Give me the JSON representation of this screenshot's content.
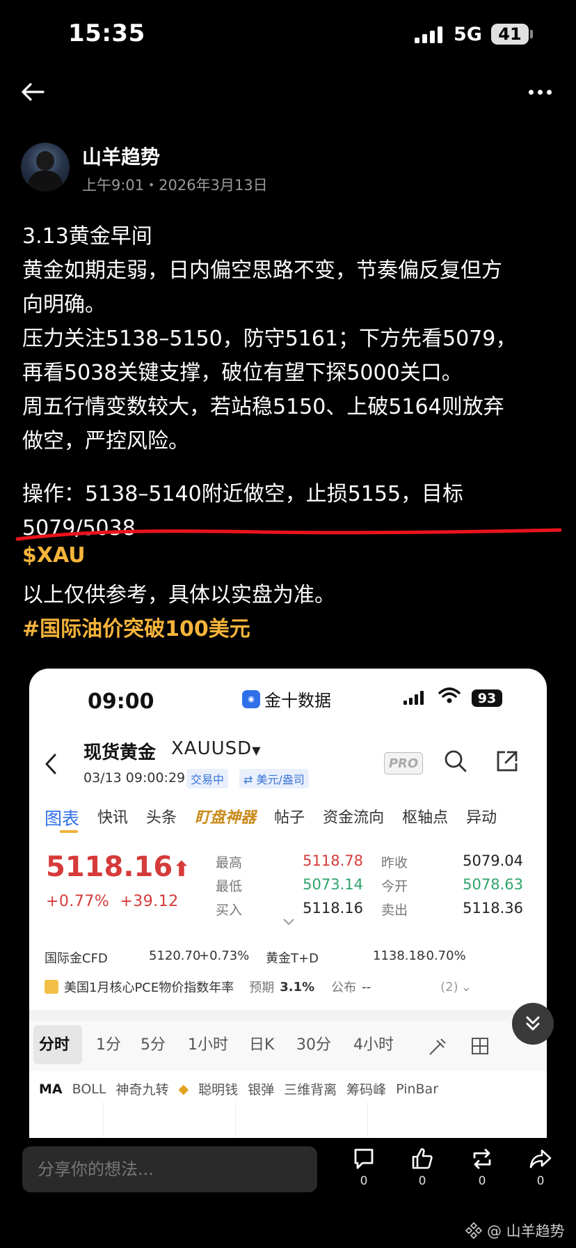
{
  "status_bar": {
    "time": "15:35",
    "network": "5G",
    "battery": "41"
  },
  "post": {
    "author": "山羊趋势",
    "meta": "上午9:01・2026年3月13日",
    "lines": [
      "3.13黄金早间",
      "黄金如期走弱，日内偏空思路不变，节奏偏反复但方",
      "向明确。",
      "压力关注5138–5150，防守5161；下方先看5079，",
      "再看5038关键支撑，破位有望下探5000关口。",
      "周五行情变数较大，若站稳5150、上破5164则放弃",
      "做空，严控风险。"
    ],
    "operation_line1": "操作：5138–5140附近做空，止损5155，目标",
    "operation_line2": "5079/5038",
    "cashtag": "$XAU",
    "disclaimer": "以上仅供参考，具体以实盘为准。",
    "hashtag": "#国际油价突破100美元"
  },
  "screenshot": {
    "status": {
      "time": "09:00",
      "app": "金十数据",
      "battery": "93"
    },
    "title": "现货黄金",
    "symbol": "XAUUSD",
    "datetime": "03/13 09:00:29",
    "badge_trading": "交易中",
    "badge_unit": "⇄ 美元/盎司",
    "pro": "PRO",
    "tabs": [
      "图表",
      "快讯",
      "头条",
      "盯盘神器",
      "帖子",
      "资金流向",
      "枢轴点",
      "异动"
    ],
    "price": "5118.16",
    "change_pct": "+0.77%",
    "change_abs": "+39.12",
    "grid": {
      "high_label": "最高",
      "high": "5118.78",
      "low_label": "最低",
      "low": "5073.14",
      "bid_label": "买入",
      "bid": "5118.16",
      "prev_close_label": "昨收",
      "prev_close": "5079.04",
      "open_label": "今开",
      "open": "5078.63",
      "ask_label": "卖出",
      "ask": "5118.36"
    },
    "cfd": {
      "label": "国际金CFD",
      "value": "5120.70",
      "pct": "+0.73%"
    },
    "td": {
      "label": "黄金T+D",
      "value": "1138.18",
      "pct": "-0.70%"
    },
    "pce": {
      "label": "美国1月核心PCE物价指数年率",
      "expect_label": "预期",
      "expect": "3.1%",
      "publish_label": "公布",
      "publish": "--",
      "count": "(2)"
    },
    "periods": [
      "分时",
      "1分",
      "5分",
      "1小时",
      "日K",
      "30分",
      "4小时"
    ],
    "indicators": [
      "MA",
      "BOLL",
      "神奇九转",
      "聪明钱",
      "银弹",
      "三维背离",
      "筹码峰",
      "PinBar"
    ]
  },
  "bottom": {
    "comment_placeholder": "分享你的想法...",
    "comments": "0",
    "likes": "0",
    "reposts": "0",
    "shares": "0",
    "watermark": "@ 山羊趋势"
  },
  "colors": {
    "accent_gold": "#f4b43b",
    "underline_red": "#e8141c",
    "price_red": "#d63a3a",
    "price_green": "#2ea36b"
  }
}
